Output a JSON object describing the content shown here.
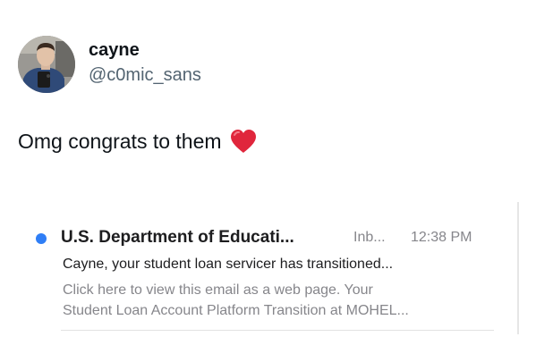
{
  "tweet": {
    "display_name": "cayne",
    "handle": "@c0mic_sans",
    "text": "Omg congrats to them",
    "emoji_icon": "red-heart-icon",
    "heart_color": "#e0263c"
  },
  "email": {
    "unread_dot_color": "#2f7ef6",
    "sender": "U.S. Department of Educati...",
    "mailbox": "Inb...",
    "time": "12:38 PM",
    "subject": "Cayne, your student loan servicer has transitioned...",
    "preview_line1": "Click here to view this email as a web page. Your",
    "preview_line2": "Student Loan Account Platform Transition at MOHEL..."
  }
}
